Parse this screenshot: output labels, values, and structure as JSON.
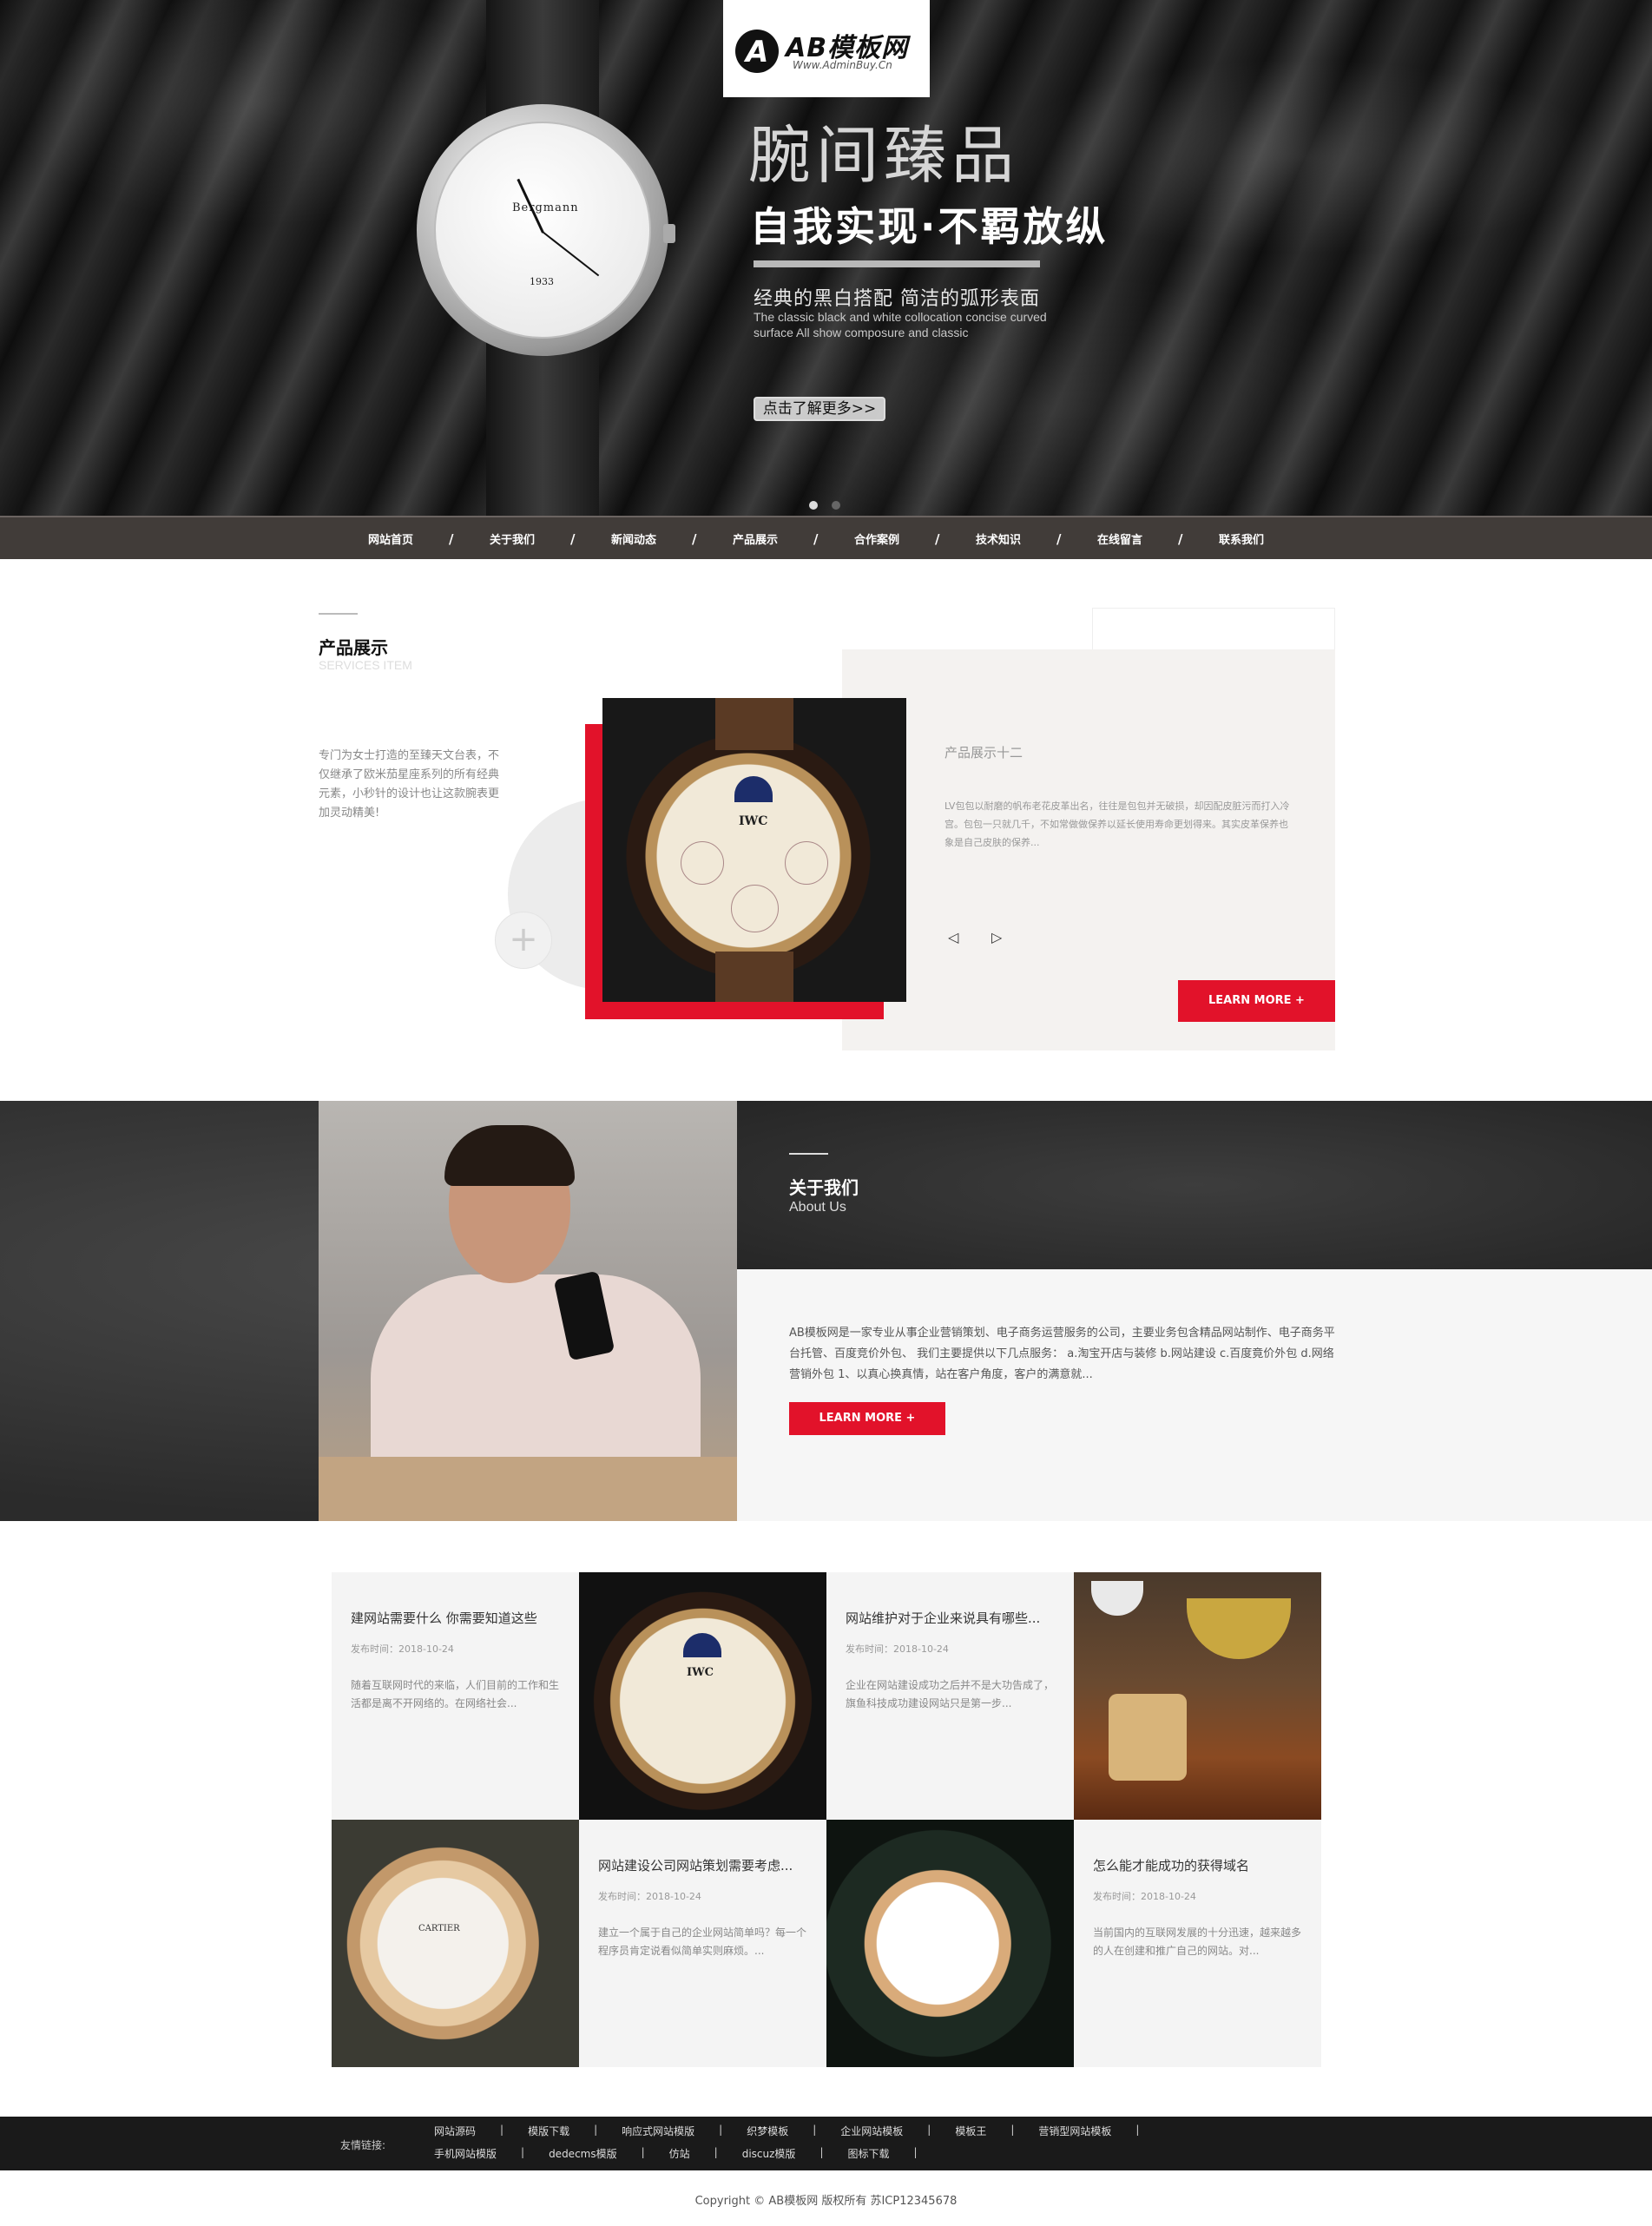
{
  "logo": {
    "title": "AB模板网",
    "subtitle": "Www.AdminBuy.Cn"
  },
  "hero": {
    "watch_brand": "Bergmann",
    "watch_year": "1933",
    "headline": "腕间臻品",
    "subheadline": "自我实现·不羁放纵",
    "tagline_cn": "经典的黑白搭配 简洁的弧形表面",
    "tagline_en": "The classic black and white collocation concise curved surface All show composure and classic",
    "button": "点击了解更多>>"
  },
  "nav": {
    "items": [
      "网站首页",
      "关于我们",
      "新闻动态",
      "产品展示",
      "合作案例",
      "技术知识",
      "在线留言",
      "联系我们"
    ],
    "separator": "/"
  },
  "product": {
    "title": "产品展示",
    "subtitle": "SERVICES ITEM",
    "description": "专门为女士打造的至臻天文台表，不仅继承了欧米茄星座系列的所有经典元素，小秒针的设计也让这款腕表更加灵动精美!",
    "plus": "+",
    "image_label": "IWC",
    "item_name": "产品展示十二",
    "item_text": "LV包包以耐磨的帆布老花皮革出名，往往是包包并无破损，却因配皮脏污而打入冷宫。包包一只就几千，不如常做做保养以延长使用寿命更划得来。其实皮革保养也象是自己皮肤的保养...",
    "prev": "◁",
    "next": "▷",
    "button": "LEARN MORE +"
  },
  "about": {
    "title": "关于我们",
    "subtitle": "About Us",
    "text": "AB模板网是一家专业从事企业营销策划、电子商务运营服务的公司，主要业务包含精品网站制作、电子商务平台托管、百度竞价外包、 我们主要提供以下几点服务： a.淘宝开店与装修 b.网站建设 c.百度竟价外包 d.网络营销外包 1、以真心换真情，站在客户角度，客户的满意就...",
    "button": "LEARN MORE +"
  },
  "news": [
    {
      "title": "建网站需要什么 你需要知道这些",
      "date": "发布时间：2018-10-24",
      "body": "随着互联网时代的来临，人们目前的工作和生活都是离不开网络的。在网络社会..."
    },
    {
      "title": "网站维护对于企业来说具有哪些...",
      "date": "发布时间：2018-10-24",
      "body": "企业在网站建设成功之后并不是大功告成了，旗鱼科技成功建设网站只是第一步..."
    },
    {
      "title": "网站建设公司网站策划需要考虑...",
      "date": "发布时间：2018-10-24",
      "body": "建立一个属于自己的企业网站简单吗？每一个程序员肯定说看似简单实则麻烦。..."
    },
    {
      "title": "怎么能才能成功的获得域名",
      "date": "发布时间：2018-10-24",
      "body": "当前国内的互联网发展的十分迅速，越来越多的人在创建和推广自己的网站。对..."
    }
  ],
  "news_images": {
    "iwc": "IWC",
    "cartier": "CARTIER"
  },
  "footer": {
    "label": "友情链接:",
    "row1": [
      "网站源码",
      "模版下载",
      "响应式网站模版",
      "织梦模板",
      "企业网站模板",
      "模板王",
      "营销型网站模板"
    ],
    "row2": [
      "手机网站模版",
      "dedecms模版",
      "仿站",
      "discuz模版",
      "图标下载"
    ],
    "separator": "|",
    "copyright": "Copyright © AB模板网 版权所有   苏ICP12345678"
  },
  "colors": {
    "accent": "#e2122a",
    "nav_bg": "#413c39",
    "footer_bg": "#1a1a1a"
  }
}
